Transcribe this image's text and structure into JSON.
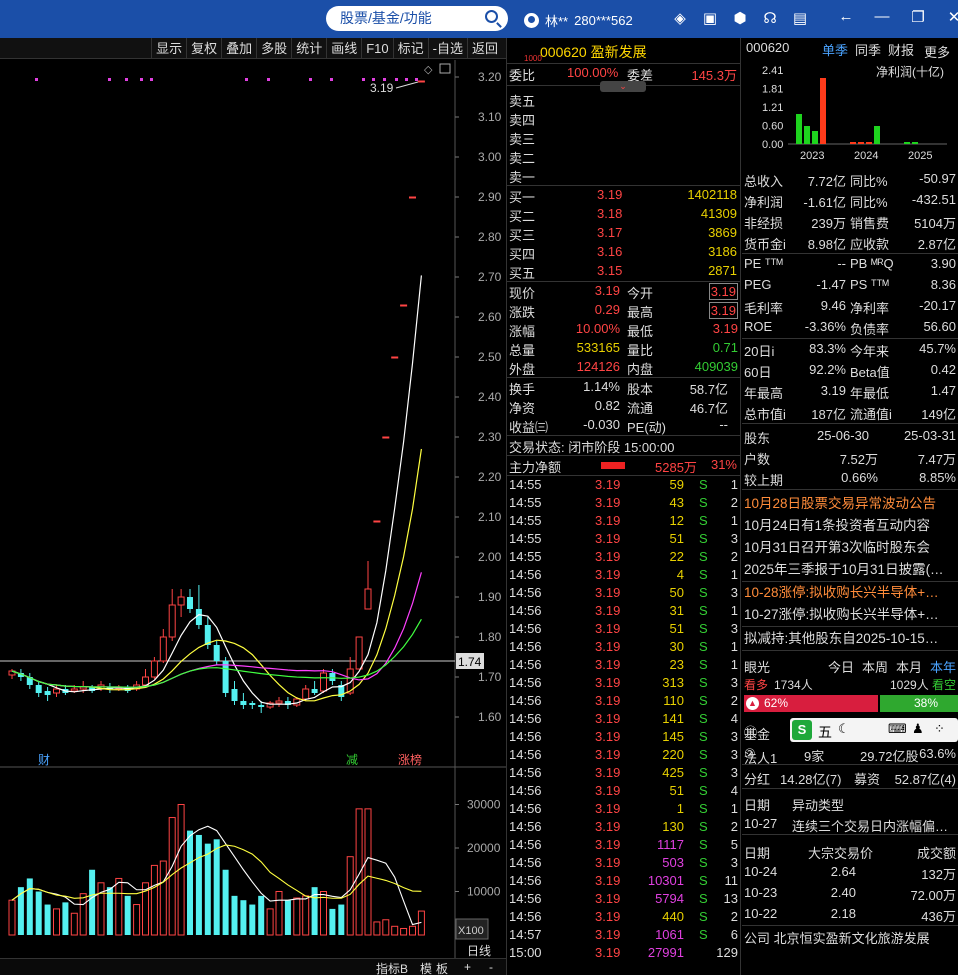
{
  "topbar": {
    "search_placeholder": "股票/基金/功能",
    "username": "林**",
    "account": "280***562"
  },
  "chart_toolbar": [
    "显示",
    "复权",
    "叠加",
    "多股",
    "统计",
    "画线",
    "F10",
    "标记",
    "-自选",
    "返回"
  ],
  "kline": {
    "price_axis": [
      "3.20",
      "3.10",
      "3.00",
      "2.90",
      "2.80",
      "2.70",
      "2.60",
      "2.50",
      "2.40",
      "2.30",
      "2.20",
      "2.10",
      "2.00",
      "1.90",
      "1.80",
      "1.70",
      "1.60"
    ],
    "current_price_label": "1.74",
    "last_price_annotation": "3.19",
    "markers": {
      "cai": "财",
      "jian": "减",
      "zhangbang": "涨榜"
    },
    "volume_axis": [
      "30000",
      "20000",
      "10000"
    ],
    "volume_unit": "X100",
    "period": "日线",
    "bottom_tabs": [
      "指标B",
      "模",
      "板",
      "+",
      "-"
    ]
  },
  "quote": {
    "code": "000620",
    "name": "盈新发展",
    "mini_tag": "1000",
    "weibi_label": "委比",
    "weibi": "100.00%",
    "weicha_label": "委差",
    "weicha": "145.3万",
    "sell": [
      {
        "label": "卖五",
        "price": "",
        "vol": ""
      },
      {
        "label": "卖四",
        "price": "",
        "vol": ""
      },
      {
        "label": "卖三",
        "price": "",
        "vol": ""
      },
      {
        "label": "卖二",
        "price": "",
        "vol": ""
      },
      {
        "label": "卖一",
        "price": "",
        "vol": ""
      }
    ],
    "buy": [
      {
        "label": "买一",
        "price": "3.19",
        "vol": "1402118"
      },
      {
        "label": "买二",
        "price": "3.18",
        "vol": "41309"
      },
      {
        "label": "买三",
        "price": "3.17",
        "vol": "3869"
      },
      {
        "label": "买四",
        "price": "3.16",
        "vol": "3186"
      },
      {
        "label": "买五",
        "price": "3.15",
        "vol": "2871"
      }
    ],
    "stats": [
      {
        "l1": "现价",
        "v1": "3.19",
        "c1": "red",
        "l2": "今开",
        "v2": "3.19",
        "c2": "red",
        "box": true
      },
      {
        "l1": "涨跌",
        "v1": "0.29",
        "c1": "red",
        "l2": "最高",
        "v2": "3.19",
        "c2": "red",
        "box": true
      },
      {
        "l1": "涨幅",
        "v1": "10.00%",
        "c1": "red",
        "l2": "最低",
        "v2": "3.19",
        "c2": "red",
        "box": false
      },
      {
        "l1": "总量",
        "v1": "533165",
        "c1": "yellow",
        "l2": "量比",
        "v2": "0.71",
        "c2": "green",
        "box": false
      },
      {
        "l1": "外盘",
        "v1": "124126",
        "c1": "red",
        "l2": "内盘",
        "v2": "409039",
        "c2": "green",
        "box": false
      }
    ],
    "stats2": [
      {
        "l1": "换手",
        "v1": "1.14%",
        "l2": "股本",
        "v2": "58.7亿"
      },
      {
        "l1": "净资",
        "v1": "0.82",
        "l2": "流通",
        "v2": "46.7亿"
      },
      {
        "l1": "收益㈢",
        "v1": "-0.030",
        "l2": "PE(动)",
        "v2": "--"
      }
    ],
    "status": "交易状态: 闭市阶段 15:00:00",
    "mainflow_label": "主力净额",
    "mainflow": "5285万",
    "mainflow_pct": "31%",
    "ticks": [
      {
        "t": "14:55",
        "p": "3.19",
        "v": "59",
        "c": "yellow",
        "s": "S",
        "n": "1"
      },
      {
        "t": "14:55",
        "p": "3.19",
        "v": "43",
        "c": "yellow",
        "s": "S",
        "n": "2"
      },
      {
        "t": "14:55",
        "p": "3.19",
        "v": "12",
        "c": "yellow",
        "s": "S",
        "n": "1"
      },
      {
        "t": "14:55",
        "p": "3.19",
        "v": "51",
        "c": "yellow",
        "s": "S",
        "n": "3"
      },
      {
        "t": "14:55",
        "p": "3.19",
        "v": "22",
        "c": "yellow",
        "s": "S",
        "n": "2"
      },
      {
        "t": "14:56",
        "p": "3.19",
        "v": "4",
        "c": "yellow",
        "s": "S",
        "n": "1"
      },
      {
        "t": "14:56",
        "p": "3.19",
        "v": "50",
        "c": "yellow",
        "s": "S",
        "n": "3"
      },
      {
        "t": "14:56",
        "p": "3.19",
        "v": "31",
        "c": "yellow",
        "s": "S",
        "n": "1"
      },
      {
        "t": "14:56",
        "p": "3.19",
        "v": "51",
        "c": "yellow",
        "s": "S",
        "n": "3"
      },
      {
        "t": "14:56",
        "p": "3.19",
        "v": "30",
        "c": "yellow",
        "s": "S",
        "n": "1"
      },
      {
        "t": "14:56",
        "p": "3.19",
        "v": "23",
        "c": "yellow",
        "s": "S",
        "n": "1"
      },
      {
        "t": "14:56",
        "p": "3.19",
        "v": "313",
        "c": "yellow",
        "s": "S",
        "n": "3"
      },
      {
        "t": "14:56",
        "p": "3.19",
        "v": "110",
        "c": "yellow",
        "s": "S",
        "n": "2"
      },
      {
        "t": "14:56",
        "p": "3.19",
        "v": "141",
        "c": "yellow",
        "s": "S",
        "n": "4"
      },
      {
        "t": "14:56",
        "p": "3.19",
        "v": "145",
        "c": "yellow",
        "s": "S",
        "n": "3"
      },
      {
        "t": "14:56",
        "p": "3.19",
        "v": "220",
        "c": "yellow",
        "s": "S",
        "n": "3"
      },
      {
        "t": "14:56",
        "p": "3.19",
        "v": "425",
        "c": "yellow",
        "s": "S",
        "n": "3"
      },
      {
        "t": "14:56",
        "p": "3.19",
        "v": "51",
        "c": "yellow",
        "s": "S",
        "n": "4"
      },
      {
        "t": "14:56",
        "p": "3.19",
        "v": "1",
        "c": "yellow",
        "s": "S",
        "n": "1"
      },
      {
        "t": "14:56",
        "p": "3.19",
        "v": "130",
        "c": "yellow",
        "s": "S",
        "n": "2"
      },
      {
        "t": "14:56",
        "p": "3.19",
        "v": "1117",
        "c": "magenta",
        "s": "S",
        "n": "5"
      },
      {
        "t": "14:56",
        "p": "3.19",
        "v": "503",
        "c": "magenta",
        "s": "S",
        "n": "3"
      },
      {
        "t": "14:56",
        "p": "3.19",
        "v": "10301",
        "c": "magenta",
        "s": "S",
        "n": "11"
      },
      {
        "t": "14:56",
        "p": "3.19",
        "v": "5794",
        "c": "magenta",
        "s": "S",
        "n": "13"
      },
      {
        "t": "14:56",
        "p": "3.19",
        "v": "440",
        "c": "yellow",
        "s": "S",
        "n": "2"
      },
      {
        "t": "14:57",
        "p": "3.19",
        "v": "1061",
        "c": "magenta",
        "s": "S",
        "n": "6"
      },
      {
        "t": "15:00",
        "p": "3.19",
        "v": "27991",
        "c": "magenta",
        "s": "",
        "n": "129"
      }
    ]
  },
  "right": {
    "code": "000620",
    "tabs": [
      "单季",
      "同季",
      "财报",
      "更多"
    ],
    "mini_chart": {
      "title": "净利润(十亿)",
      "y_labels": [
        "2.41",
        "1.81",
        "1.21",
        "0.60",
        "0.00"
      ],
      "x_labels": [
        "2023",
        "2024",
        "2025"
      ]
    },
    "fin": [
      {
        "l1": "总收入",
        "v1": "7.72亿",
        "l2": "同比%",
        "v2": "-50.97"
      },
      {
        "l1": "净利润",
        "v1": "-1.61亿",
        "l2": "同比%",
        "v2": "-432.51"
      },
      {
        "l1": "非经损",
        "v1": "239万",
        "l2": "销售费",
        "v2": "5104万"
      },
      {
        "l1": "货币金i",
        "v1": "8.98亿",
        "l2": "应收款",
        "v2": "2.87亿"
      }
    ],
    "val": [
      {
        "l1": "PE ᵀᵀᴹ",
        "v1": "--",
        "l2": "PB ᴹᴿQ",
        "v2": "3.90"
      },
      {
        "l1": "PEG",
        "v1": "-1.47",
        "l2": "PS ᵀᵀᴹ",
        "v2": "8.36"
      },
      {
        "l1": "毛利率",
        "v1": "9.46",
        "l2": "净利率",
        "v2": "-20.17"
      },
      {
        "l1": "ROE",
        "v1": "-3.36%",
        "l2": "负债率",
        "v2": "56.60"
      }
    ],
    "perf": [
      {
        "l1": "20日i",
        "v1": "83.3%",
        "l2": "今年来",
        "v2": "45.7%"
      },
      {
        "l1": "60日",
        "v1": "92.2%",
        "l2": "Beta值",
        "v2": "0.42"
      },
      {
        "l1": "年最高",
        "v1": "3.19",
        "l2": "年最低",
        "v2": "1.47"
      },
      {
        "l1": "总市值i",
        "v1": "187亿",
        "l2": "流通值i",
        "v2": "149亿"
      }
    ],
    "holders": {
      "label": "股东",
      "d1": "25-06-30",
      "d2": "25-03-31",
      "rows": [
        {
          "l": "户数",
          "v1": "7.52万",
          "v2": "7.47万"
        },
        {
          "l": "较上期",
          "v1": "0.66%",
          "v2": "8.85%"
        }
      ]
    },
    "news": [
      {
        "text": "10月28日股票交易异常波动公告",
        "c": "#ff8c3a"
      },
      {
        "text": "10月24日有1条投资者互动内容",
        "c": "#ddd"
      },
      {
        "text": "10月31日召开第3次临时股东会",
        "c": "#ddd"
      },
      {
        "text": "2025年三季报于10月31日披露(…",
        "c": "#ddd"
      }
    ],
    "news2": [
      {
        "text": "10-28涨停:拟收购长兴半导体+…",
        "c": "#ff8c3a"
      },
      {
        "text": "10-27涨停:拟收购长兴半导体+…",
        "c": "#ddd"
      }
    ],
    "news3": "拟减持:其他股东自2025-10-15…",
    "yanguang": {
      "label": "眼光",
      "tabs": [
        "今日",
        "本周",
        "本月",
        "本年"
      ],
      "bull_label": "看多",
      "bull_count": "1734人",
      "bear_count": "1029人",
      "bear_label": "看空",
      "bull_pct": "62%",
      "bear_pct": "38%"
    },
    "fund": {
      "label": "基金",
      "wu": "五"
    },
    "faren": {
      "label": "法人1",
      "v1": "9家",
      "v2": "29.72亿股",
      "v3": "63.6%"
    },
    "fenhong": {
      "l1": "分红",
      "v1": "14.28亿(7)",
      "l2": "募资",
      "v2": "52.87亿(4)"
    },
    "abnormal": {
      "h1": "日期",
      "h2": "异动类型",
      "date": "10-27",
      "text": "连续三个交易日内涨幅偏…"
    },
    "block": {
      "h1": "日期",
      "h2": "大宗交易价",
      "h3": "成交额",
      "rows": [
        {
          "d": "10-24",
          "p": "2.64",
          "a": "132万"
        },
        {
          "d": "10-23",
          "p": "2.40",
          "a": "72.00万"
        },
        {
          "d": "10-22",
          "p": "2.18",
          "a": "436万"
        }
      ]
    },
    "company": "公司  北京恒实盈新文化旅游发展"
  },
  "colors": {
    "topbar": "#1b4fa8",
    "up": "#ff4444",
    "down": "#54f0f0",
    "ma5": "#ffffff",
    "ma10": "#ffff40",
    "ma20": "#ff40ff",
    "ma60": "#40ff40"
  }
}
